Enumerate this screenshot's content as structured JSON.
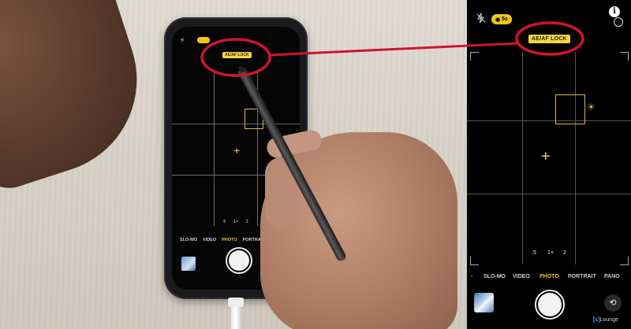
{
  "scene": {
    "phone_screen": {
      "ae_af_label": "AE/AF LOCK",
      "zoom_options": [
        ".5",
        "1×",
        "2"
      ],
      "modes": [
        "SLO-MO",
        "VIDEO",
        "PHOTO",
        "PORTRAIT"
      ],
      "selected_mode": "PHOTO"
    }
  },
  "camera_ui": {
    "live_photo_badge": "5s",
    "ae_af_label": "AE/AF LOCK",
    "zoom_options": [
      ".5",
      "1×",
      "2"
    ],
    "modes": [
      "SLO-MO",
      "VIDEO",
      "PHOTO",
      "PORTRAIT",
      "PANO"
    ],
    "selected_mode": "PHOTO",
    "info_glyph": "i",
    "brand": {
      "prefix": "[c]",
      "name": "Lounge"
    }
  },
  "icons": {
    "flash": "flash-off-icon",
    "live": "live-photo-icon",
    "info": "info-icon",
    "flip": "camera-flip-icon",
    "sun": "exposure-sun-icon"
  },
  "colors": {
    "accent_yellow": "#f5c518",
    "annotation_red": "#d0142c",
    "ae_lock_bg": "#f5d445"
  }
}
